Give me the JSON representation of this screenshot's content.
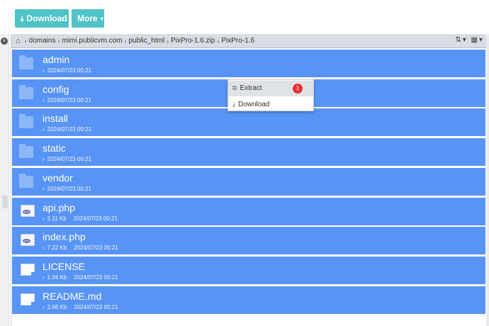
{
  "toolbar": {
    "download_label": "Download",
    "more_label": "More"
  },
  "path": {
    "segments": [
      "domains",
      "mimi.publicvm.com",
      "public_html",
      "PixPro-1.6.zip",
      "PixPro-1.6"
    ]
  },
  "files": [
    {
      "name": "admin",
      "type": "folder",
      "size": "",
      "date": "2024/07/23 00:21"
    },
    {
      "name": "config",
      "type": "folder",
      "size": "",
      "date": "2024/07/23 00:21"
    },
    {
      "name": "install",
      "type": "folder",
      "size": "",
      "date": "2024/07/23 00:21"
    },
    {
      "name": "static",
      "type": "folder",
      "size": "",
      "date": "2024/07/23 00:21"
    },
    {
      "name": "vendor",
      "type": "folder",
      "size": "",
      "date": "2024/07/23 00:21"
    },
    {
      "name": "api.php",
      "type": "php",
      "size": "2.11 Kb",
      "date": "2024/07/23 00:21"
    },
    {
      "name": "index.php",
      "type": "php",
      "size": "7.22 Kb",
      "date": "2024/07/23 00:21"
    },
    {
      "name": "LICENSE",
      "type": "doc",
      "size": "1.04 Kb",
      "date": "2024/07/23 00:21"
    },
    {
      "name": "README.md",
      "type": "doc",
      "size": "2.66 Kb",
      "date": "2024/07/23 00:21"
    }
  ],
  "context_menu": {
    "extract_label": "Extract",
    "download_label": "Download",
    "badge": "1"
  },
  "colors": {
    "accent": "#4fc3c7",
    "selection": "#5894f5",
    "badge": "#e8302f"
  },
  "icons": [
    "download-icon",
    "home-icon",
    "chevron-right-icon",
    "folder-icon",
    "php-file-icon",
    "document-icon",
    "extract-icon",
    "sort-icon",
    "view-grid-icon"
  ]
}
